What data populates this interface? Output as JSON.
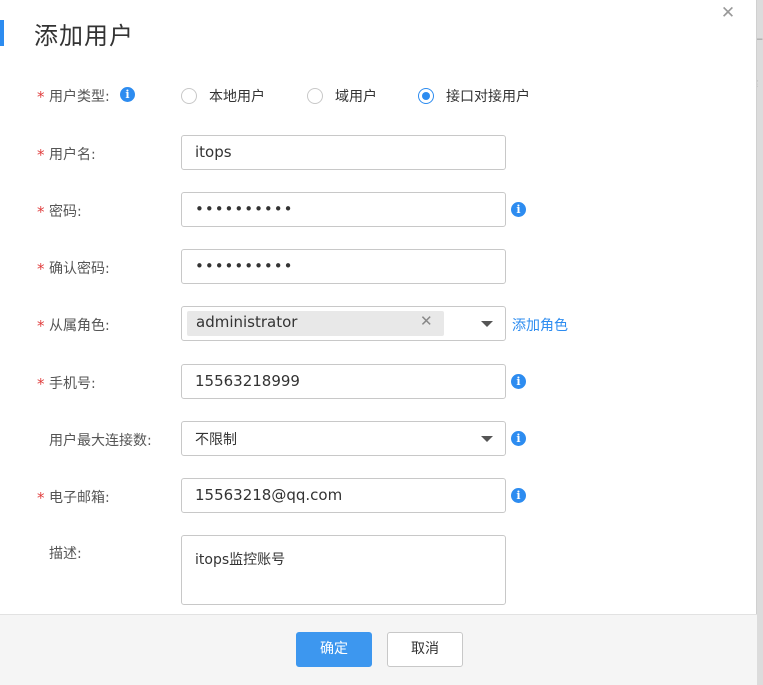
{
  "dialog": {
    "title": "添加用户",
    "close_icon": "close-icon"
  },
  "fields": {
    "user_type": {
      "label": "用户类型:",
      "required": true,
      "options": [
        "本地用户",
        "域用户",
        "接口对接用户"
      ],
      "selected": "接口对接用户"
    },
    "username": {
      "label": "用户名:",
      "required": true,
      "value": "itops"
    },
    "password": {
      "label": "密码:",
      "required": true,
      "value": "••••••••••"
    },
    "confirm_password": {
      "label": "确认密码:",
      "required": true,
      "value": "••••••••••"
    },
    "role": {
      "label": "从属角色:",
      "required": true,
      "tags": [
        "administrator"
      ],
      "add_link": "添加角色"
    },
    "phone": {
      "label": "手机号:",
      "required": true,
      "value": "15563218999"
    },
    "max_connections": {
      "label": "用户最大连接数:",
      "required": false,
      "value": "不限制"
    },
    "email": {
      "label": "电子邮箱:",
      "required": true,
      "value": "15563218@qq.com"
    },
    "description": {
      "label": "描述:",
      "required": false,
      "value": "itops监控账号"
    }
  },
  "footer": {
    "confirm_label": "确定",
    "cancel_label": "取消"
  },
  "colors": {
    "accent": "#2d8cf0",
    "required_star": "#e03e3e",
    "primary_button": "#3d97ef"
  },
  "icons": [
    "info-icon",
    "close-icon",
    "chevron-down-icon",
    "remove-tag-icon"
  ]
}
